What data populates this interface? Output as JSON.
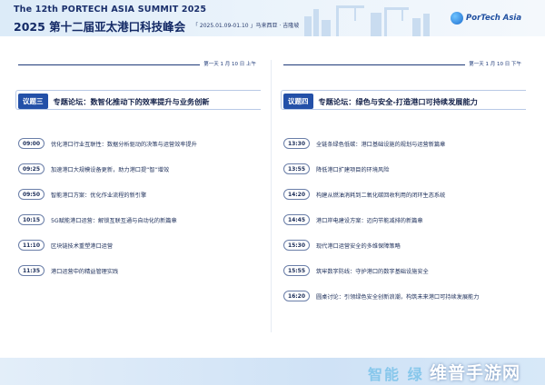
{
  "header": {
    "title_en": "The 12th PORTECH ASIA SUMMIT 2025",
    "title_cn": "2025 第十二届亚太港口科技峰会",
    "meta": "「 2025.01.09-01.10 」马来西亚 · 吉隆坡",
    "logo_text": "PorTech Asia"
  },
  "left": {
    "date": "第一天 1 月 10 日 上午",
    "badge": "议题三",
    "topic": "专题论坛：数智化推动下的效率提升与业务创新",
    "sessions": [
      {
        "time": "09:00",
        "title": "优化港口行业互联性：数据分析驱动的决策与运营效率提升"
      },
      {
        "time": "09:25",
        "title": "加速港口大规模设备更新，助力港口提“智”增效"
      },
      {
        "time": "09:50",
        "title": "智能港口方案：优化作业流程的新引擎"
      },
      {
        "time": "10:15",
        "title": "5G赋能港口运营：解锁互联互通与自动化的新篇章"
      },
      {
        "time": "11:10",
        "title": "区块链技术重塑港口运营"
      },
      {
        "time": "11:35",
        "title": "港口运营中的精益管理实践"
      }
    ]
  },
  "right": {
    "date": "第一天 1 月 10 日 下午",
    "badge": "议题四",
    "topic": "专题论坛：绿色与安全-打造港口可持续发展能力",
    "sessions": [
      {
        "time": "13:30",
        "title": "全链条绿色低碳：港口基础设施的规划与运营新篇章"
      },
      {
        "time": "13:55",
        "title": "降低港口扩建项目的环境风险"
      },
      {
        "time": "14:20",
        "title": "构建从燃油消耗到二氧化碳回收利用的闭环生态系统"
      },
      {
        "time": "14:45",
        "title": "港口岸电建设方案：迈向节能减排的新篇章"
      },
      {
        "time": "15:30",
        "title": "现代港口运营安全的多维保障策略"
      },
      {
        "time": "15:55",
        "title": "筑牢数字防线：守护港口的数字基础设施安全"
      },
      {
        "time": "16:20",
        "title": "圆桌讨论：引领绿色安全创新浪潮，构筑未来港口可持续发展能力"
      }
    ]
  },
  "footer": {
    "slogan": "智能  绿",
    "watermark": "维普手游网"
  },
  "colors": {
    "accent": "#2350a8",
    "navy": "#1a2c58"
  }
}
